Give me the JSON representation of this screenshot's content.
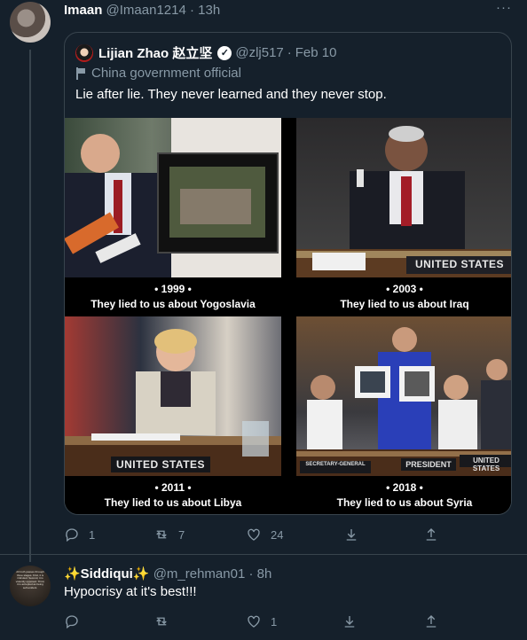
{
  "tweet1": {
    "author_name": "Imaan",
    "handle": "@Imaan1214",
    "separator": "·",
    "time": "13h",
    "more_icon": "more-dots-icon",
    "quote": {
      "author_name": "Lijian Zhao 赵立坚",
      "handle": "@zlj517",
      "separator": "·",
      "date": "Feb 10",
      "label": "China government official",
      "text": "Lie after lie. They never learned and they never stop.",
      "panels": [
        {
          "year": "• 1999 •",
          "caption": "They lied to us about Yogoslavia"
        },
        {
          "year": "• 2003 •",
          "caption": "They lied to us about Iraq",
          "sign": "UNITED STATES"
        },
        {
          "year": "• 2011 •",
          "caption": "They lied to us about Libya",
          "sign": "UNITED STATES"
        },
        {
          "year": "• 2018 •",
          "caption": "They lied to us about Syria",
          "sign": "UNITED STATES",
          "sign2": "PRESIDENT",
          "sign3": "SECRETARY-GENERAL"
        }
      ]
    },
    "actions": {
      "reply_count": "1",
      "retweet_count": "7",
      "like_count": "24"
    }
  },
  "tweet2": {
    "author_name": "✨Siddiqui✨",
    "handle": "@m_rehman01",
    "separator": "·",
    "time": "8h",
    "avatar_text": "All truth passes through three stages. First, it is ridiculed. Second, it is violently opposed. Third, it is accepted as being self-evident.",
    "text": "Hypocrisy at it's best!!!",
    "actions": {
      "reply_count": "",
      "retweet_count": "",
      "like_count": "1"
    }
  },
  "colors": {
    "background": "#15202b",
    "muted": "#8899a6",
    "border": "#38444d"
  }
}
